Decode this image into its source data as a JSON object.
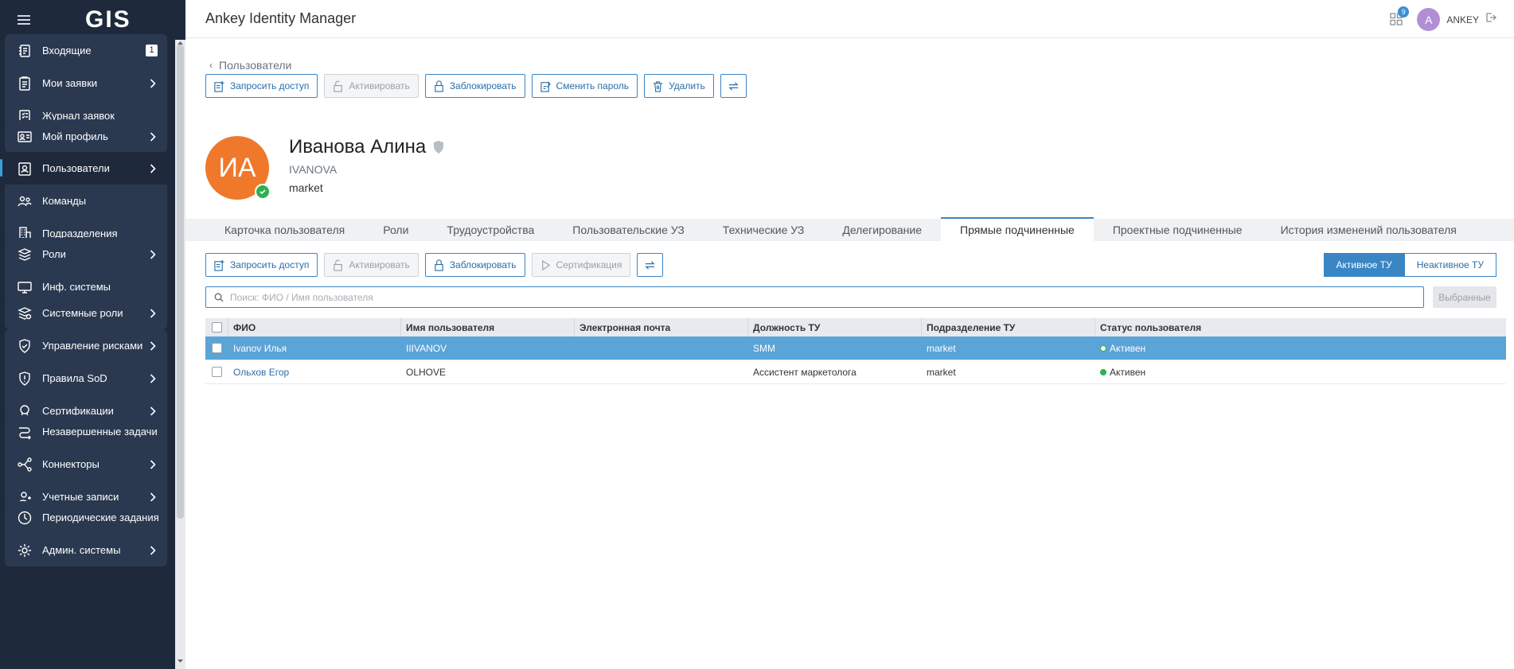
{
  "sidebar": {
    "logo": "GIS",
    "groups": [
      {
        "items": [
          {
            "label": "Входящие",
            "icon": "inbox-icon",
            "badge": "1"
          },
          {
            "label": "Мои заявки",
            "icon": "requests-icon"
          },
          {
            "label": "Журнал заявок",
            "icon": "journal-icon"
          }
        ]
      },
      {
        "items": [
          {
            "label": "Мой профиль",
            "icon": "profile-card-icon"
          }
        ]
      },
      {
        "items": [
          {
            "label": "Пользователи",
            "icon": "users-icon"
          },
          {
            "label": "Команды",
            "icon": "teams-icon"
          },
          {
            "label": "Подразделения",
            "icon": "building-icon"
          }
        ]
      },
      {
        "items": [
          {
            "label": "Роли",
            "icon": "roles-icon"
          },
          {
            "label": "Инф. системы",
            "icon": "systems-icon"
          }
        ]
      },
      {
        "items": [
          {
            "label": "Системные роли",
            "icon": "system-roles-icon"
          }
        ]
      },
      {
        "items": [
          {
            "label": "Управление рисками",
            "icon": "shield-check-icon"
          },
          {
            "label": "Правила SoD",
            "icon": "sod-icon"
          },
          {
            "label": "Сертификации",
            "icon": "certificate-icon"
          }
        ]
      },
      {
        "items": [
          {
            "label": "Незавершенные задачи",
            "icon": "tasks-icon"
          },
          {
            "label": "Коннекторы",
            "icon": "connectors-icon"
          },
          {
            "label": "Учетные записи",
            "icon": "accounts-icon"
          }
        ]
      },
      {
        "items": [
          {
            "label": "Периодические задания",
            "icon": "clock-icon"
          },
          {
            "label": "Админ. системы",
            "icon": "gear-icon"
          }
        ]
      }
    ]
  },
  "header": {
    "title": "Ankey Identity Manager",
    "apps_badge": "9",
    "avatar_letter": "A",
    "username": "ANKEY"
  },
  "breadcrumb": {
    "label": "Пользователи"
  },
  "toolbar_top": {
    "request_access": "Запросить доступ",
    "activate": "Активировать",
    "block": "Заблокировать",
    "change_password": "Сменить пароль",
    "delete": "Удалить"
  },
  "profile": {
    "initials": "ИА",
    "name": "Иванова Алина",
    "login": "IVANOVA",
    "department": "market"
  },
  "tabs": [
    "Карточка пользователя",
    "Роли",
    "Трудоустройства",
    "Пользовательские УЗ",
    "Технические УЗ",
    "Делегирование",
    "Прямые подчиненные",
    "Проектные подчиненные",
    "История изменений пользователя"
  ],
  "active_tab": "Прямые подчиненные",
  "toolbar_sub": {
    "request_access": "Запросить доступ",
    "activate": "Активировать",
    "block": "Заблокировать",
    "certification": "Сертификация"
  },
  "segment": {
    "active": "Активное ТУ",
    "inactive": "Неактивное ТУ"
  },
  "search": {
    "placeholder": "Поиск: ФИО / Имя пользователя",
    "selected_label": "Выбранные"
  },
  "table": {
    "columns": [
      "ФИО",
      "Имя пользователя",
      "Электронная почта",
      "Должность ТУ",
      "Подразделение ТУ",
      "Статус пользователя"
    ],
    "rows": [
      {
        "fio": "Ivanov Илья",
        "username": "IIIVANOV",
        "email": "",
        "position": "SMM",
        "dept": "market",
        "status": "Активен"
      },
      {
        "fio": "Ольхов Егор",
        "username": "OLHOVE",
        "email": "",
        "position": "Ассистент маркетолога",
        "dept": "market",
        "status": "Активен"
      }
    ]
  },
  "colors": {
    "accent": "#3a86c4",
    "sidebar": "#1e2a3b",
    "avatar": "#f0782a",
    "status_active": "#2bb24c"
  }
}
